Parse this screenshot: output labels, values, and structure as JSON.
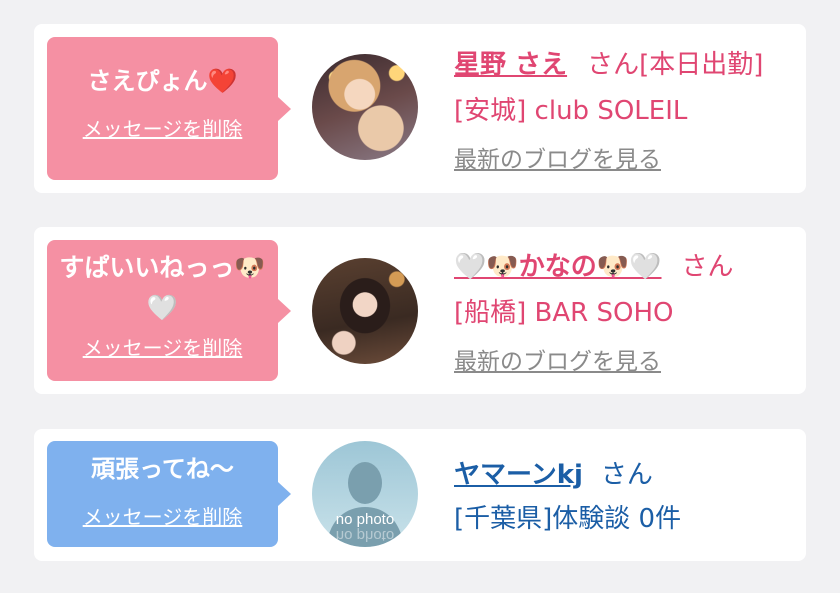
{
  "delete_label": "メッセージを削除",
  "blog_label": "最新のブログを見る",
  "cards": [
    {
      "message": "さえぴょん❤️",
      "name": "星野 さえ",
      "suffix": "さん[本日出勤]",
      "shop": "[安城] club SOLEIL",
      "bubble_color": "#f590a3"
    },
    {
      "message": "すぱいいねっっ🐶🤍",
      "name": "🤍🐶かなの🐶🤍",
      "suffix": "さん",
      "shop": "[船橋] BAR SOHO",
      "bubble_color": "#f590a3"
    },
    {
      "message": "頑張ってね〜",
      "name": "ヤマーンkj",
      "suffix": "さん",
      "shop": "[千葉県]体験談 0件",
      "bubble_color": "#7fb1ee",
      "avatar_text": "no photo"
    }
  ],
  "colors": {
    "pink_accent": "#e04672",
    "blue_accent": "#1b5ea6",
    "pink_bubble": "#f590a3",
    "blue_bubble": "#7fb1ee",
    "link_gray": "#8a8a8a"
  }
}
